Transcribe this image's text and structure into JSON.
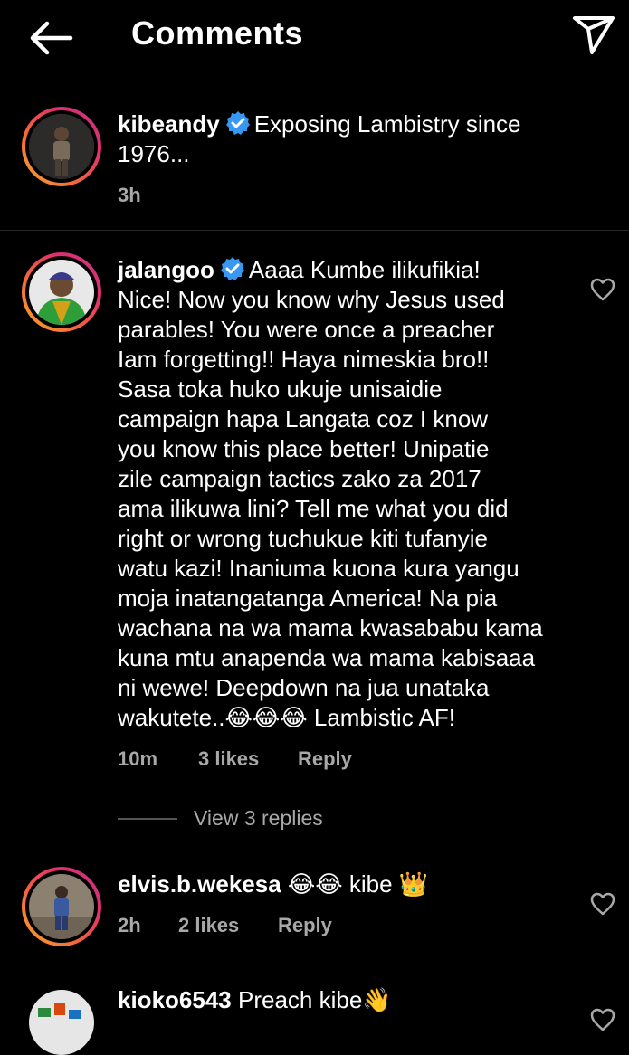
{
  "header": {
    "title": "Comments",
    "back_icon": "arrow-left-icon",
    "share_icon": "send-icon"
  },
  "caption": {
    "username": "kibeandy",
    "text": "Exposing Lambistry since 1976...",
    "time": "3h"
  },
  "comments": [
    {
      "username": "jalangoo",
      "lines": [
        "Aaaa Kumbe ilikufikia!",
        "Nice! Now you know why Jesus used",
        "parables! You were once a preacher",
        "Iam forgetting!! Haya nimeskia bro!!",
        "Sasa toka huko ukuje unisaidie",
        "campaign hapa Langata coz I know",
        "you know this place better! Unipatie",
        "zile campaign tactics zako za 2017",
        "ama ilikuwa lini? Tell me what you did",
        "right or wrong tuchukue kiti tufanyie",
        "watu kazi! Inaniuma kuona kura yangu",
        "moja inatangatanga America! Na pia",
        "wachana na wa mama kwasababu kama",
        "kuna mtu anapenda wa mama kabisaaa",
        "ni wewe! Deepdown na jua unataka",
        "wakutete..😂😂😂 Lambistic AF!"
      ],
      "time": "10m",
      "likes": "3 likes",
      "reply": "Reply",
      "view_replies": "View 3 replies"
    },
    {
      "username": "elvis.b.wekesa",
      "text": "😂😂 kibe 👑",
      "time": "2h",
      "likes": "2 likes",
      "reply": "Reply"
    },
    {
      "username": "kioko6543",
      "text": "Preach kibe👋"
    }
  ],
  "colors": {
    "background": "#000000",
    "text": "#ffffff",
    "meta": "#a8a8a8",
    "verified": "#3897f0"
  }
}
